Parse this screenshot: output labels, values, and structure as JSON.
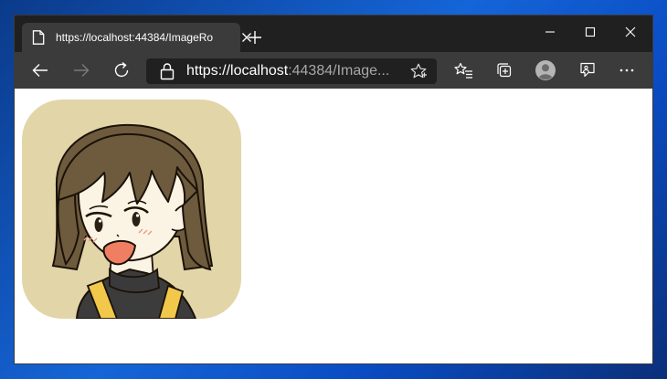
{
  "browser": {
    "tab": {
      "title": "https://localhost:44384/ImageRo",
      "favicon": "page-icon",
      "close_icon": "close-icon"
    },
    "new_tab_icon": "plus-icon",
    "window_controls": [
      "minimize-icon",
      "maximize-icon",
      "close-icon"
    ]
  },
  "toolbar": {
    "back_icon": "back-arrow-icon",
    "forward_icon": "forward-arrow-icon",
    "refresh_icon": "refresh-icon",
    "address": {
      "scheme": "https://",
      "host": "localhost",
      "rest": ":44384/Image...",
      "lock_icon": "lock-icon",
      "favorite_icon": "star-icon"
    },
    "favorites_icon": "favorites-list-icon",
    "collections_icon": "collections-icon",
    "profile_icon": "profile-avatar-icon",
    "feedback_icon": "feedback-icon",
    "more_icon": "more-dots-icon"
  },
  "content": {
    "image": "rounded-avatar-illustration",
    "colors": {
      "image_background": "#e2d5a8",
      "hair": "#6e5b3e",
      "shirt": "#3c3c3c",
      "strap": "#f2c84b"
    }
  }
}
